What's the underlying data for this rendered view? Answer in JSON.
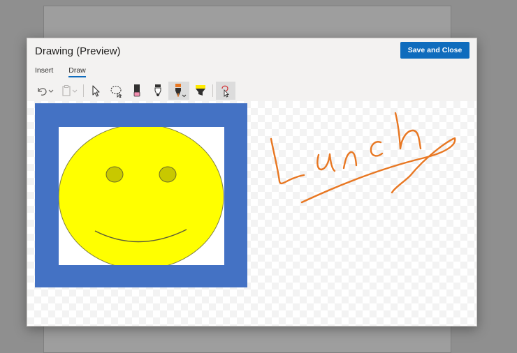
{
  "dialog": {
    "title": "Drawing (Preview)",
    "save_close_label": "Save and Close"
  },
  "tabs": [
    {
      "label": "Insert",
      "active": false
    },
    {
      "label": "Draw",
      "active": true
    }
  ],
  "toolbar": {
    "tools": [
      "undo-icon",
      "undo-dropdown-icon",
      "paste-icon",
      "select-icon",
      "lasso-select-icon",
      "eraser-icon",
      "black-pen-icon",
      "orange-pen-icon",
      "highlighter-icon",
      "ink-to-shape-icon"
    ],
    "selected_tool": "orange-pen-icon"
  },
  "canvas": {
    "handwriting_text": "Lunch",
    "ink_color": "#e87722",
    "frame_color": "#4472c4",
    "face_color": "#ffff00",
    "eye_color": "#c8c800"
  }
}
